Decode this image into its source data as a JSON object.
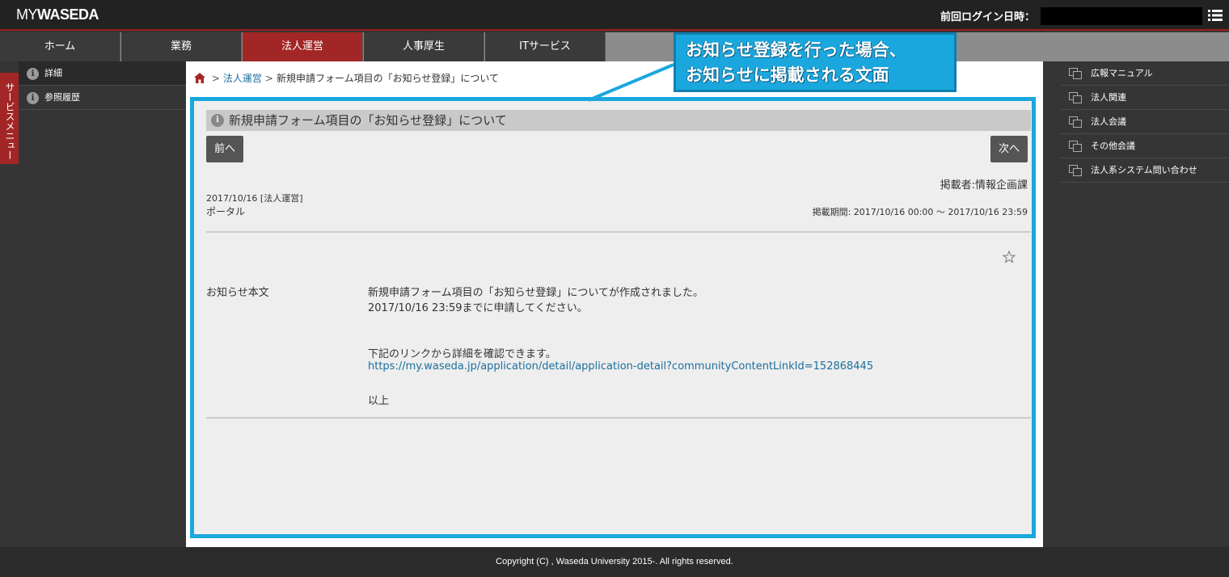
{
  "header": {
    "logo_my": "MY",
    "logo_waseda": "WASEDA",
    "last_login_label": "前回ログイン日時："
  },
  "nav": {
    "tabs": [
      {
        "label": "ホーム"
      },
      {
        "label": "業務"
      },
      {
        "label": "法人運営",
        "active": true
      },
      {
        "label": "人事厚生"
      },
      {
        "label": "ITサービス"
      }
    ]
  },
  "left_sidebar": {
    "service_menu_label": "サービスメニュー",
    "items": [
      {
        "label": "詳細",
        "icon": "info-icon"
      },
      {
        "label": "参照履歴",
        "icon": "info-icon"
      }
    ]
  },
  "breadcrumb": {
    "home_icon": "home-icon",
    "separator": ">",
    "category": "法人運営",
    "current": "新規申請フォーム項目の「お知らせ登録」について"
  },
  "article": {
    "title": "新規申請フォーム項目の「お知らせ登録」について",
    "prev_label": "前へ",
    "next_label": "次へ",
    "poster": "掲載者:情報企画課",
    "date_category": "2017/10/16 [法人運営]",
    "portal": "ポータル",
    "period": "掲載期間: 2017/10/16 00:00 〜 2017/10/16 23:59",
    "body_label": "お知らせ本文",
    "body_line1": "新規申請フォーム項目の「お知らせ登録」についてが作成されました。",
    "body_line2": "2017/10/16 23:59までに申請してください。",
    "body_line3": "下記のリンクから詳細を確認できます。",
    "body_link": "https://my.waseda.jp/application/detail/application-detail?communityContentLinkId=152868445",
    "body_closing": "以上"
  },
  "callout": {
    "line1": "お知らせ登録を行った場合、",
    "line2": "お知らせに掲載される文面"
  },
  "right_sidebar": {
    "items": [
      {
        "label": "広報マニュアル"
      },
      {
        "label": "法人関連"
      },
      {
        "label": "法人会議"
      },
      {
        "label": "その他会議"
      },
      {
        "label": "法人系システム問い合わせ"
      }
    ]
  },
  "footer": {
    "copyright": "Copyright (C) , Waseda University 2015-. All rights reserved."
  },
  "colors": {
    "accent_red": "#a32626",
    "highlight_blue": "#1aa7dd",
    "link_blue": "#1a6f9e"
  }
}
